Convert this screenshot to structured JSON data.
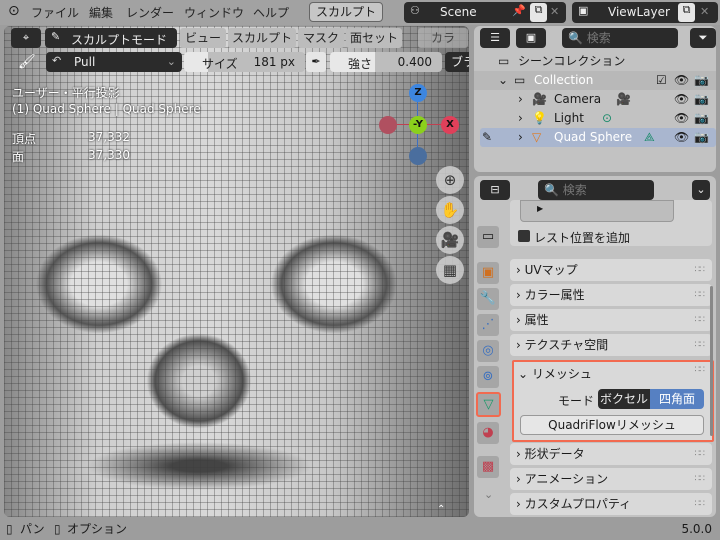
{
  "topbar": {
    "menus": [
      "ファイル",
      "編集",
      "レンダー",
      "ウィンドウ",
      "ヘルプ"
    ],
    "workspace": "スカルプト",
    "scene": "Scene",
    "view_layer": "ViewLayer"
  },
  "viewport": {
    "mode": "スカルプトモード",
    "menus": [
      "ビュー",
      "スカルプト",
      "マスク",
      "面セット",
      "カラ"
    ],
    "brush": "Pull",
    "size_label": "サイズ",
    "size_value": "181 px",
    "strength_label": "強さ",
    "strength_value": "0.400",
    "brush_more": "ブラ",
    "view_name": "ユーザー・平行投影",
    "object_info": "(1) Quad Sphere | Quad Sphere",
    "stats": [
      {
        "label": "頂点",
        "value": "37,332"
      },
      {
        "label": "面",
        "value": "37,330"
      }
    ],
    "gizmo": {
      "z": "Z",
      "y": "-Y",
      "x": "X"
    }
  },
  "outliner": {
    "search_placeholder": "検索",
    "scene_collection": "シーンコレクション",
    "items": [
      {
        "name": "Collection"
      },
      {
        "name": "Camera"
      },
      {
        "name": "Light"
      },
      {
        "name": "Quad Sphere"
      }
    ]
  },
  "properties": {
    "search_placeholder": "検索",
    "rest_position": "レスト位置を追加",
    "panels_top": [
      "UVマップ",
      "カラー属性",
      "属性",
      "テクスチャ空間"
    ],
    "remesh": {
      "title": "リメッシュ",
      "mode_label": "モード",
      "modes": [
        "ボクセル",
        "四角面"
      ],
      "active_mode": "四角面",
      "button": "QuadriFlowリメッシュ"
    },
    "panels_bottom": [
      "形状データ",
      "アニメーション",
      "カスタムプロパティ"
    ]
  },
  "status": {
    "pan": "パン",
    "options": "オプション",
    "version": "5.0.0"
  },
  "colors": {
    "highlight": "#f26a50",
    "accent": "#5680c2",
    "selected_row": "#a9b6cf"
  }
}
